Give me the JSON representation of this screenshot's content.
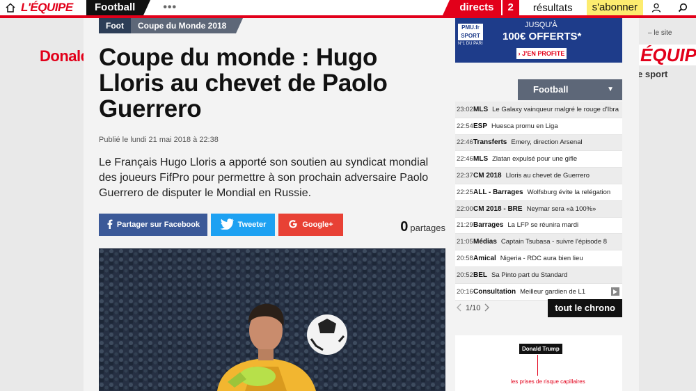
{
  "topnav": {
    "logo": "L'ÉQUIPE",
    "section": "Football",
    "more": "•••",
    "directs": "directs",
    "directs_count": "2",
    "resultats": "résultats",
    "abonner": "s'abonner"
  },
  "background_ads": {
    "left_text": "Donald",
    "right_small": "– le site",
    "right_logo": "ÉQUIPE",
    "right_sport": "e sport"
  },
  "article": {
    "breadcrumb": [
      "Foot",
      "Coupe du Monde 2018"
    ],
    "headline": "Coupe du monde : Hugo Lloris au chevet de Paolo Guerrero",
    "published": "Publié le lundi 21 mai 2018 à 22:38",
    "lead": "Le Français Hugo Lloris a apporté son soutien au syndicat mondial des joueurs FifPro pour permettre à son prochain adversaire Paolo Guerrero de disputer le Mondial en Russie.",
    "share": {
      "facebook": "Partager sur Facebook",
      "twitter": "Tweeter",
      "google": "Google+",
      "count": "0",
      "count_label": "partages"
    }
  },
  "pmu_ad": {
    "logo": "PMU.fr SPORT",
    "sub": "N°1 DU PARI",
    "jusqua": "JUSQU'À",
    "offer": "100€ OFFERTS*",
    "cta": "› J'EN PROFITE"
  },
  "chrono": {
    "select": "Football",
    "items": [
      {
        "time": "23:02",
        "cat": "MLS",
        "title": "Le Galaxy vainqueur malgré le rouge d'Ibra"
      },
      {
        "time": "22:54",
        "cat": "ESP",
        "title": "Huesca promu en Liga"
      },
      {
        "time": "22:46",
        "cat": "Transferts",
        "title": "Emery, direction Arsenal"
      },
      {
        "time": "22:46",
        "cat": "MLS",
        "title": "Zlatan expulsé pour une gifle"
      },
      {
        "time": "22:37",
        "cat": "CM 2018",
        "title": "Lloris au chevet de Guerrero"
      },
      {
        "time": "22:25",
        "cat": "ALL - Barrages",
        "title": "Wolfsburg évite la relégation"
      },
      {
        "time": "22:00",
        "cat": "CM 2018 - BRE",
        "title": "Neymar sera «à 100%»"
      },
      {
        "time": "21:29",
        "cat": "Barrages",
        "title": "La LFP se réunira mardi"
      },
      {
        "time": "21:05",
        "cat": "Médias",
        "title": "Captain Tsubasa - suivre l'épisode 8"
      },
      {
        "time": "20:58",
        "cat": "Amical",
        "title": "Nigeria - RDC aura bien lieu"
      },
      {
        "time": "20:52",
        "cat": "BEL",
        "title": "Sa Pinto part du Standard"
      },
      {
        "time": "20:16",
        "cat": "Consultation",
        "title": "Meilleur gardien de L1"
      }
    ],
    "pager": "1/10",
    "tout": "tout le chrono"
  },
  "trump_ad": {
    "tag": "Donald Trump",
    "text": "les prises de risque capillaires"
  },
  "colors": {
    "brand_red": "#e2001a",
    "navy": "#2d3e57",
    "facebook": "#3b5998",
    "twitter": "#1da1f2",
    "google": "#e84135"
  }
}
